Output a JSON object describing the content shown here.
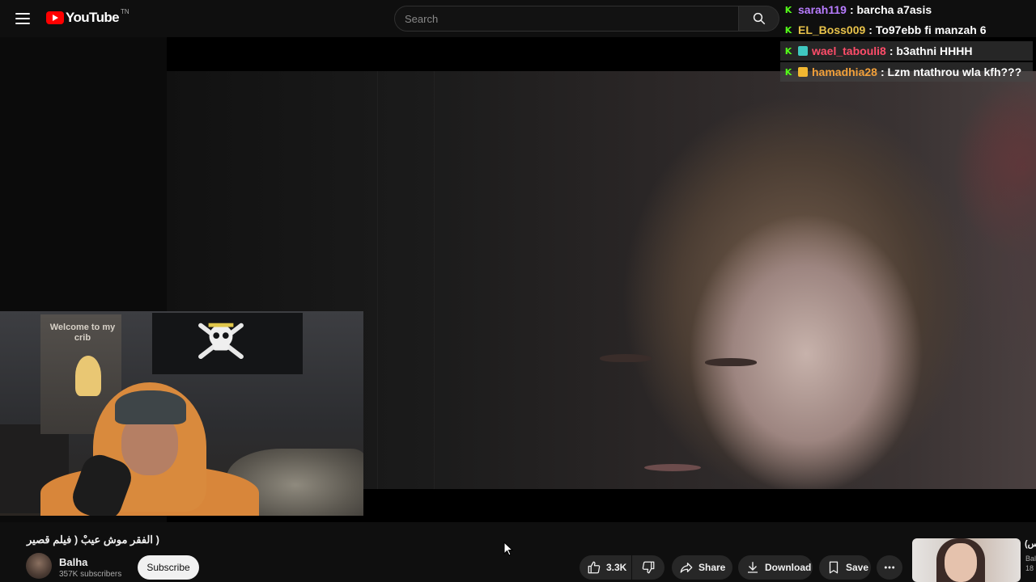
{
  "header": {
    "logo_text": "YouTube",
    "logo_tm": "TN",
    "search_placeholder": "Search"
  },
  "webcam": {
    "poster_text": "Welcome to  my crib"
  },
  "chat": {
    "messages": [
      {
        "name": "sarah119",
        "message": ": barcha a7asis",
        "name_color": "#b87cff"
      },
      {
        "name": "EL_Boss009",
        "message": ": To97ebb fi manzah 6",
        "name_color": "#e8c24a"
      },
      {
        "name": "wael_tabouli8",
        "message": ": b3athni HHHH",
        "name_color": "#ff4d6a"
      },
      {
        "name": "hamadhia28",
        "message": ": Lzm ntathrou wla kfh???",
        "name_color": "#f2a03a"
      }
    ]
  },
  "video": {
    "title": "( الفقر موش عيبْ ( فيلم قصير",
    "channel_name": "Balha",
    "subscribers": "357K subscribers",
    "subscribe_label": "Subscribe",
    "like_count": "3.3K",
    "share_label": "Share",
    "download_label": "Download",
    "save_label": "Save"
  },
  "sidebar": {
    "next_title_fragment": "(بنس",
    "next_channel_fragment": "Bal",
    "next_meta_fragment": "18"
  },
  "colors": {
    "accent_red": "#ff0000",
    "kick_green": "#53fc18",
    "background": "#0f0f0f"
  }
}
